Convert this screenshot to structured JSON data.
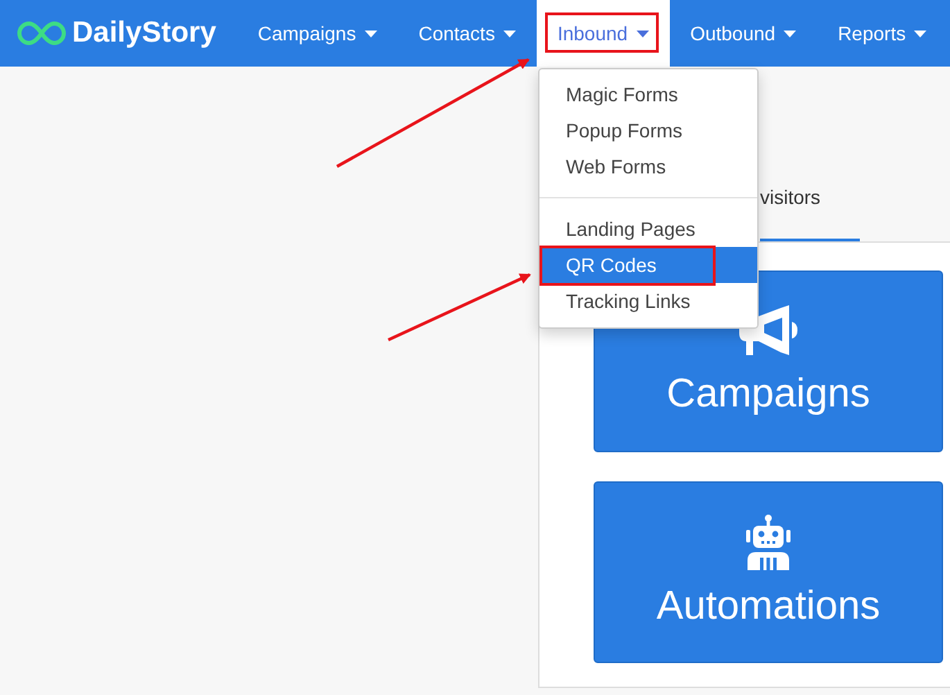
{
  "navbar": {
    "logo": "DailyStory",
    "items": [
      {
        "label": "Campaigns",
        "selected": false,
        "highlighted": false
      },
      {
        "label": "Contacts",
        "selected": false,
        "highlighted": false
      },
      {
        "label": "Inbound",
        "selected": true,
        "highlighted": true
      },
      {
        "label": "Outbound",
        "selected": false,
        "highlighted": false
      },
      {
        "label": "Reports",
        "selected": false,
        "highlighted": false
      }
    ]
  },
  "dropdown": {
    "groups": [
      [
        {
          "label": "Magic Forms",
          "selected": false,
          "highlighted": false
        },
        {
          "label": "Popup Forms",
          "selected": false,
          "highlighted": false
        },
        {
          "label": "Web Forms",
          "selected": false,
          "highlighted": false
        }
      ],
      [
        {
          "label": "Landing Pages",
          "selected": false,
          "highlighted": false
        },
        {
          "label": "QR Codes",
          "selected": true,
          "highlighted": true
        },
        {
          "label": "Tracking Links",
          "selected": false,
          "highlighted": false
        }
      ]
    ]
  },
  "tab": {
    "label": "visitors",
    "selected": true
  },
  "tiles": [
    {
      "label": "Campaigns",
      "kind": "megaphone"
    },
    {
      "label": "Automations",
      "kind": "robot"
    }
  ]
}
